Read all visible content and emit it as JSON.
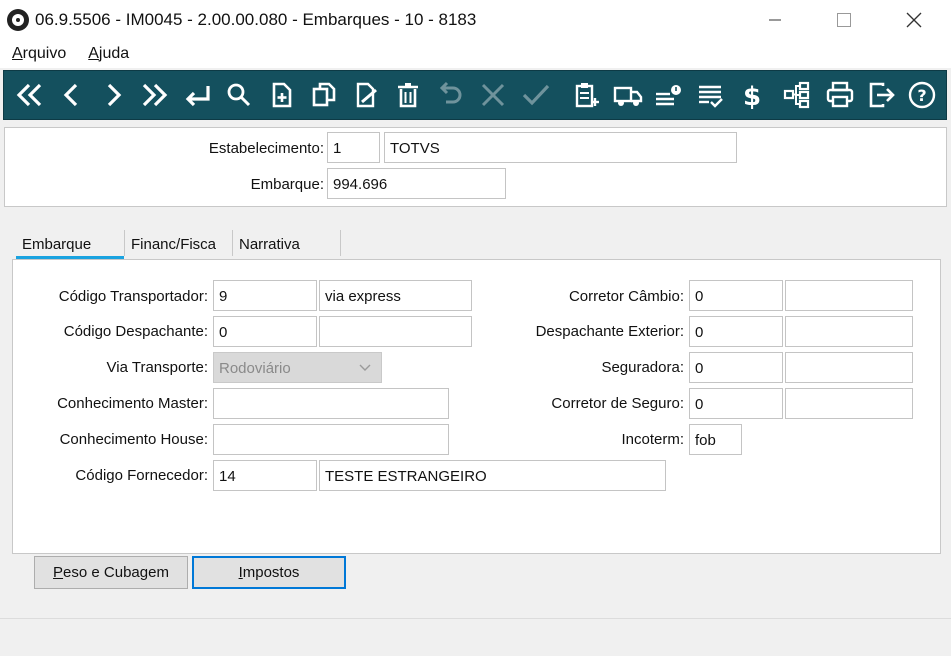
{
  "window": {
    "title": "06.9.5506 - IM0045 - 2.00.00.080 - Embarques - 10 - 8183"
  },
  "menu": {
    "items": [
      {
        "accel": "A",
        "rest": "rquivo"
      },
      {
        "accel": "A",
        "rest": "juda"
      }
    ]
  },
  "toolbar": {
    "icons": [
      "first-icon",
      "previous-icon",
      "next-icon",
      "last-icon",
      "goto-icon",
      "search-icon",
      "new-icon",
      "copy-icon",
      "edit-icon",
      "delete-icon",
      "undo-icon",
      "cancel-icon",
      "confirm-icon",
      "clipboard-add-icon",
      "truck-icon",
      "list-alert-icon",
      "list-check-icon",
      "dollar-icon",
      "hierarchy-icon",
      "print-icon",
      "exit-icon",
      "help-icon"
    ]
  },
  "header": {
    "estabelecimento_label": "Estabelecimento:",
    "estabelecimento_code": "1",
    "estabelecimento_name": "TOTVS",
    "embarque_label": "Embarque:",
    "embarque_value": "994.696"
  },
  "tabs": [
    {
      "label": "Embarque"
    },
    {
      "label": "Financ/Fisca"
    },
    {
      "label": "Narrativa"
    }
  ],
  "form": {
    "codigo_transportador": {
      "label": "Código Transportador:",
      "code": "9",
      "name": "via express"
    },
    "codigo_despachante": {
      "label": "Código Despachante:",
      "code": "0",
      "name": ""
    },
    "via_transporte": {
      "label": "Via Transporte:",
      "value": "Rodoviário"
    },
    "conhecimento_master": {
      "label": "Conhecimento Master:",
      "value": ""
    },
    "conhecimento_house": {
      "label": "Conhecimento House:",
      "value": ""
    },
    "codigo_fornecedor": {
      "label": "Código Fornecedor:",
      "code": "14",
      "name": "TESTE ESTRANGEIRO"
    },
    "corretor_cambio": {
      "label": "Corretor Câmbio:",
      "code": "0",
      "name": ""
    },
    "despachante_exterior": {
      "label": "Despachante Exterior:",
      "code": "0",
      "name": ""
    },
    "seguradora": {
      "label": "Seguradora:",
      "code": "0",
      "name": ""
    },
    "corretor_seguro": {
      "label": "Corretor de Seguro:",
      "code": "0",
      "name": ""
    },
    "incoterm": {
      "label": "Incoterm:",
      "value": "fob"
    }
  },
  "buttons": {
    "peso_accel": "P",
    "peso_rest": "eso e Cubagem",
    "impostos_accel": "I",
    "impostos_rest": "mpostos"
  },
  "colors": {
    "toolbar_bg": "#14505e",
    "active_tab_underline": "#1aa3e0",
    "focus_border": "#0078d7"
  }
}
